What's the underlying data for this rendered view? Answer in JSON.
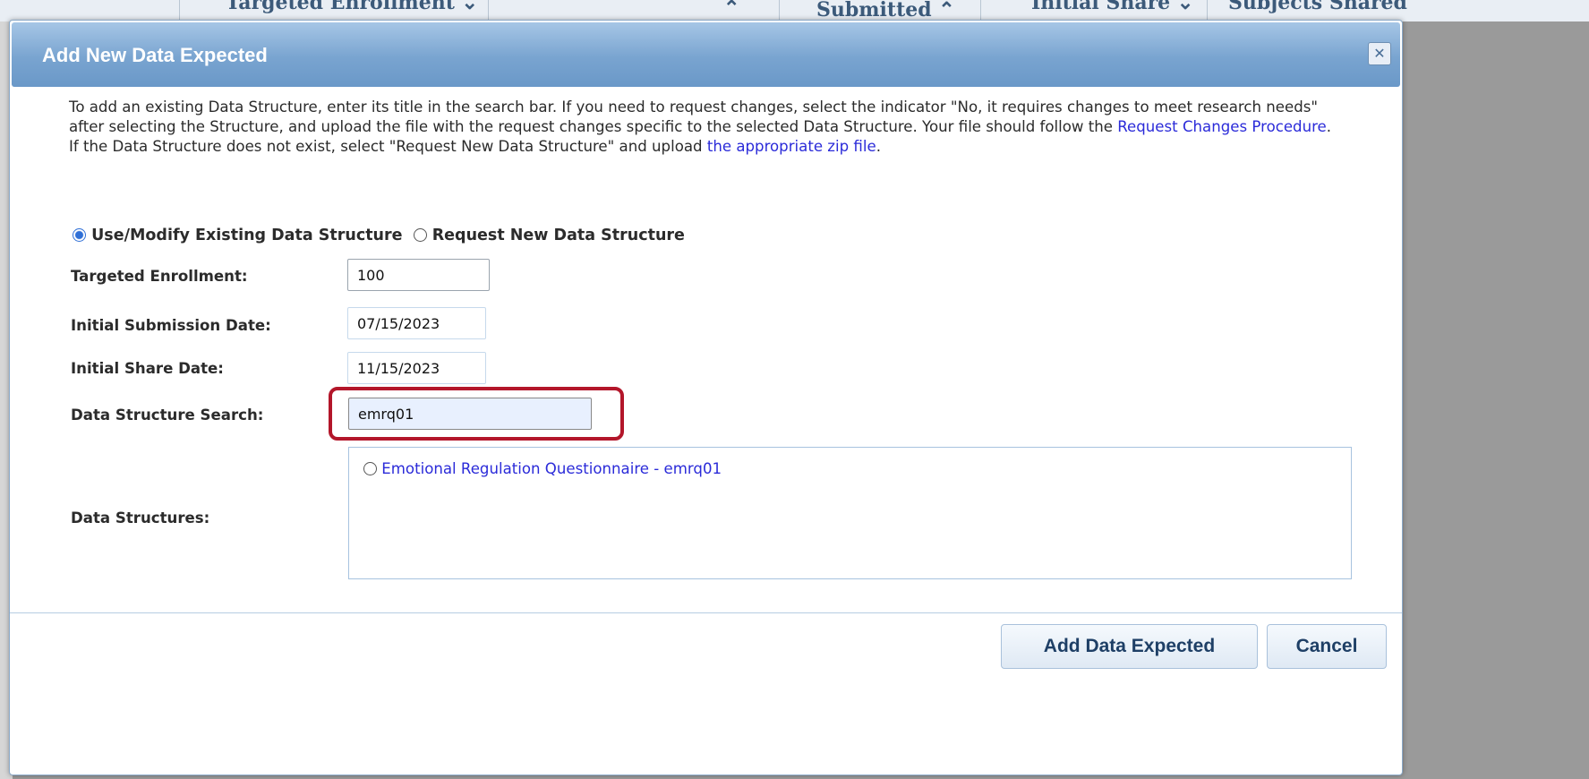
{
  "background": {
    "columns": [
      "Targeted Enrollment ⌄",
      "⌃",
      "Submitted ⌃",
      "Initial Share ⌄",
      "Subjects Shared"
    ]
  },
  "dialog": {
    "title": "Add New Data Expected",
    "close_icon": "close-icon",
    "intro_1": "To add an existing Data Structure, enter its title in the search bar. If you need to request changes, select the indicator \"No, it requires changes to meet research needs\" after selecting the Structure, and upload the file with the request changes specific to the selected Data Structure. Your file should follow the ",
    "intro_link_1": "Request Changes Procedure",
    "intro_2": ". If the Data Structure does not exist, select \"Request New Data Structure\" and upload ",
    "intro_link_2": "the appropriate zip file",
    "intro_3": ".",
    "options": {
      "use_existing": "Use/Modify Existing Data Structure",
      "request_new": "Request New Data Structure",
      "selected": "use_existing"
    },
    "form": {
      "targeted_enrollment_label": "Targeted Enrollment:",
      "targeted_enrollment_value": "100",
      "initial_submission_label": "Initial Submission Date:",
      "initial_submission_value": "07/15/2023",
      "initial_share_label": "Initial Share Date:",
      "initial_share_value": "11/15/2023",
      "search_label": "Data Structure Search:",
      "search_value": "emrq01",
      "structures_label": "Data Structures:",
      "structures": [
        "Emotional Regulation Questionnaire - emrq01"
      ]
    },
    "buttons": {
      "add": "Add Data Expected",
      "cancel": "Cancel"
    },
    "colors": {
      "highlight": "#b3162a",
      "link": "#2b2bd9",
      "titlebar": "#79a4d0"
    }
  }
}
